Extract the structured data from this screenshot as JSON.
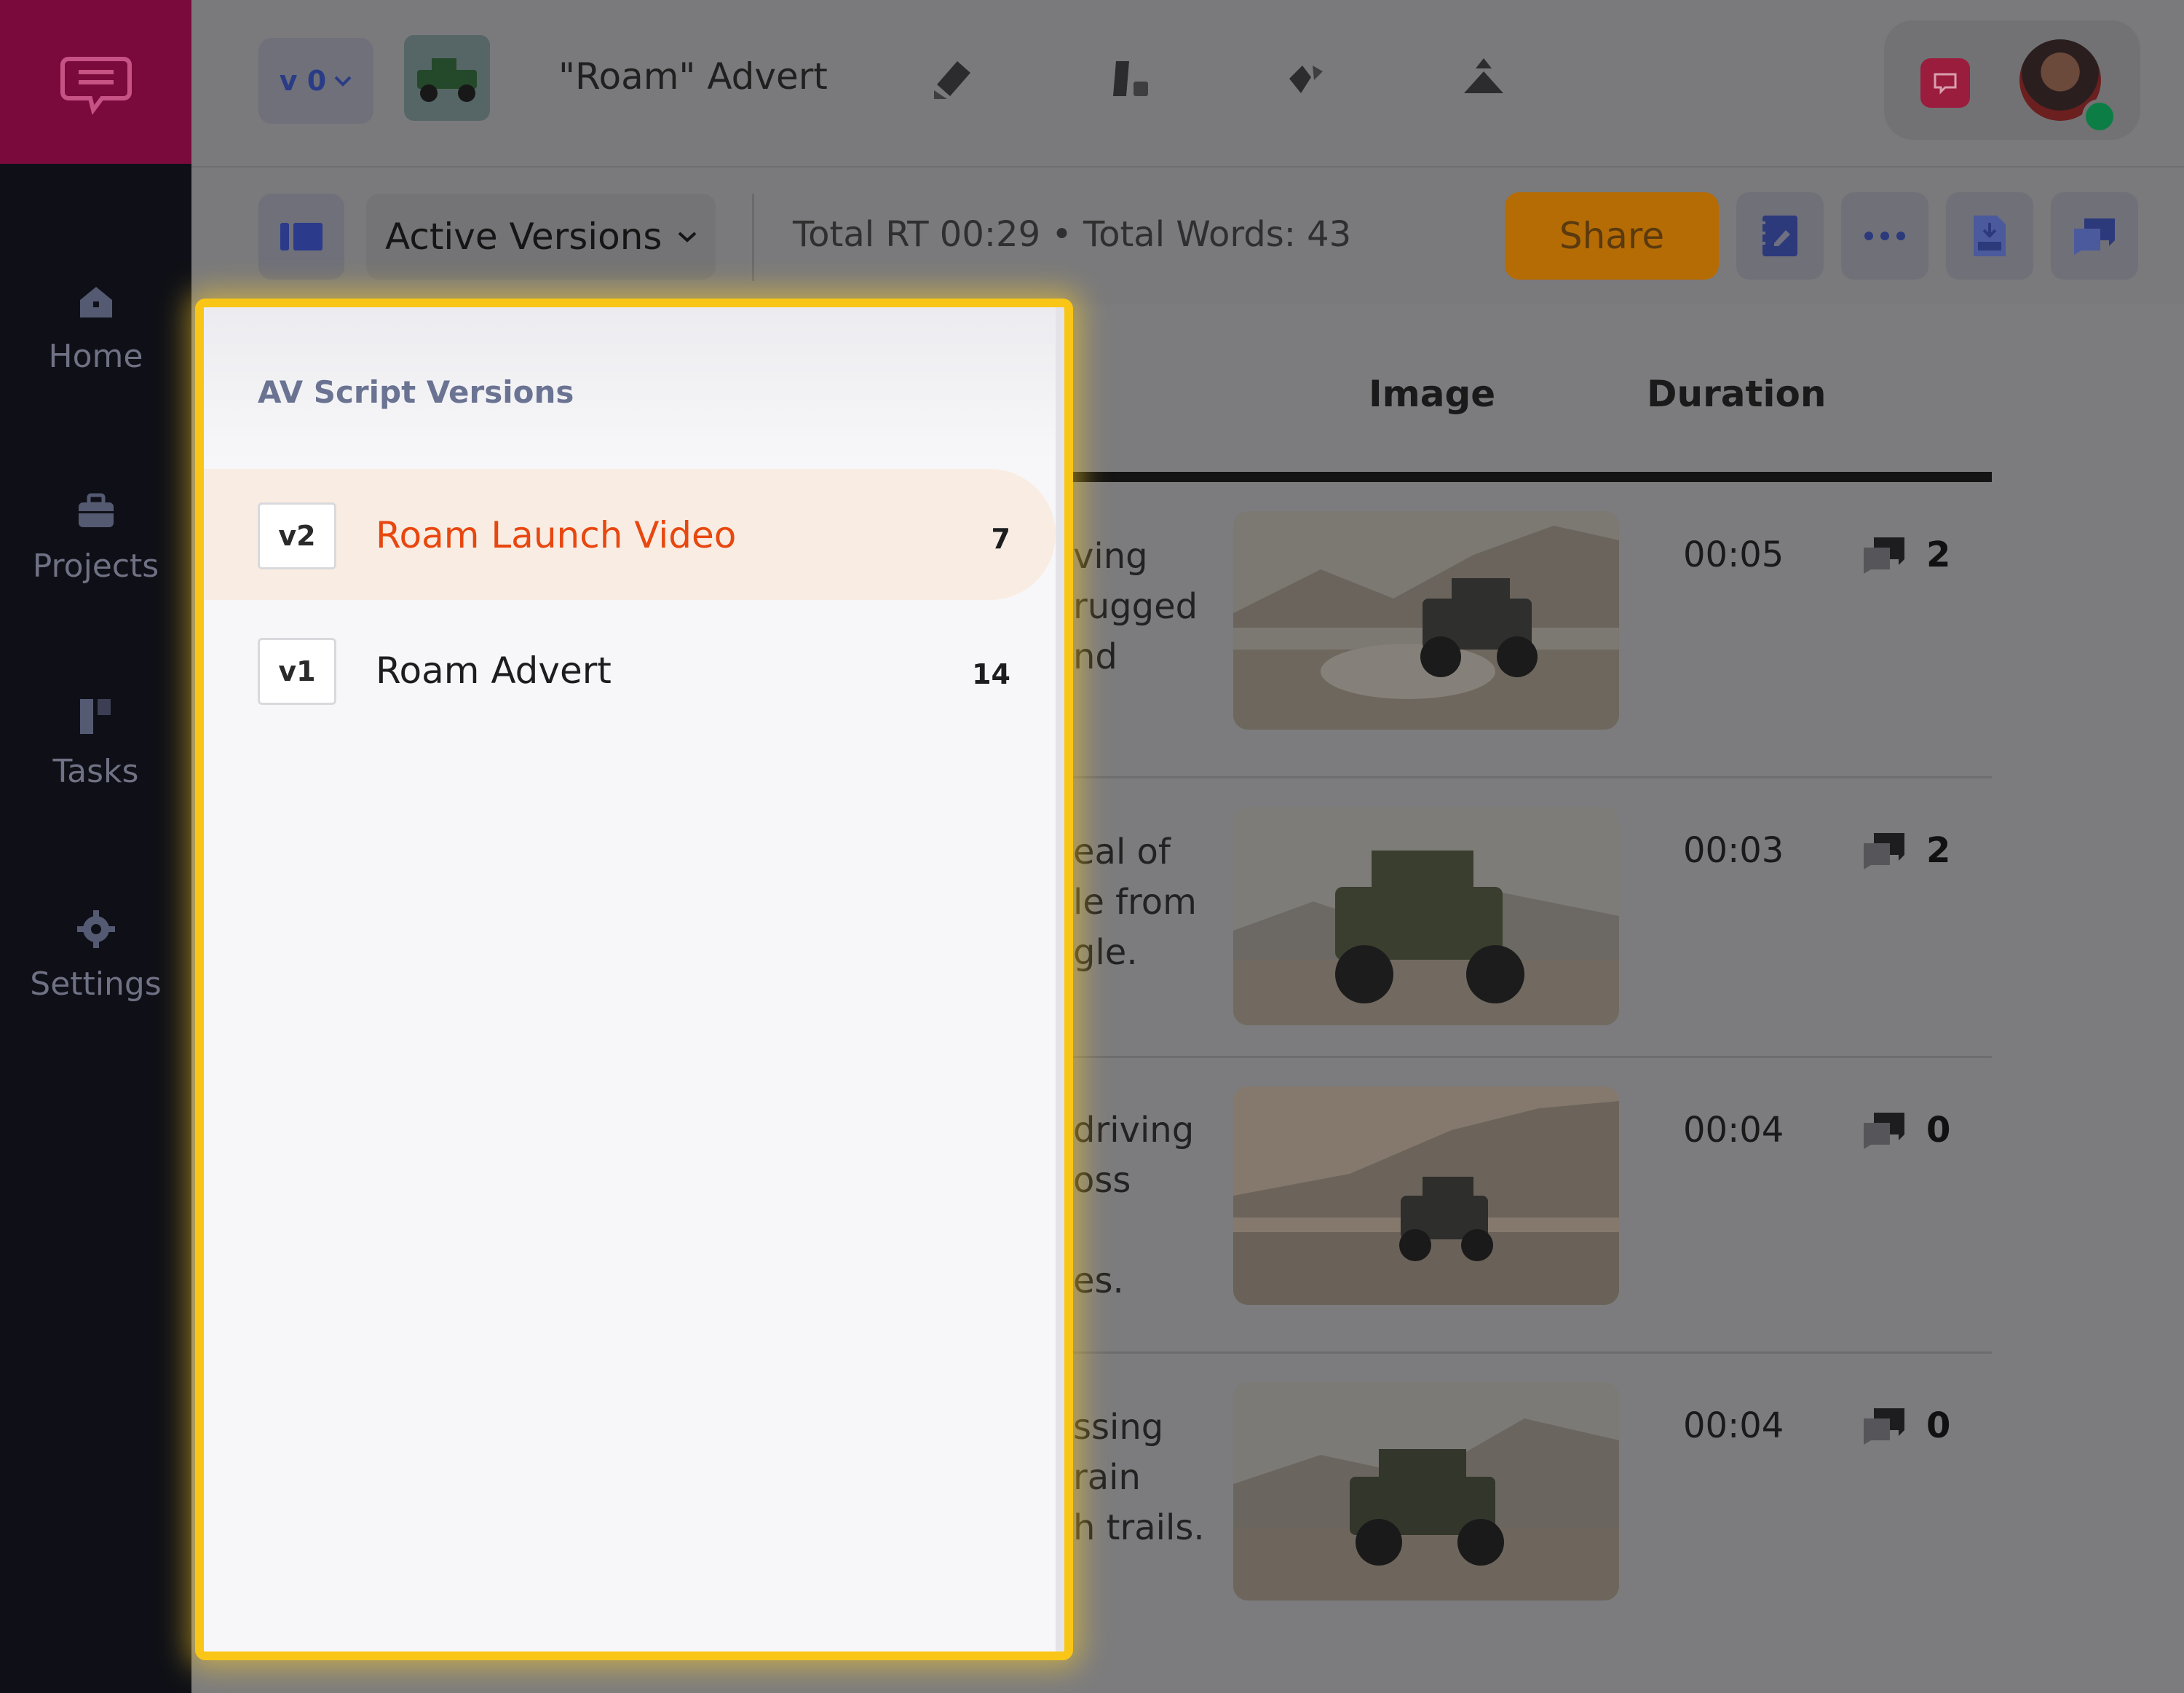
{
  "sidebar": {
    "logo_icon": "chat-logo-icon",
    "items": [
      {
        "label": "Home",
        "icon": "home-icon"
      },
      {
        "label": "Projects",
        "icon": "briefcase-icon"
      },
      {
        "label": "Tasks",
        "icon": "tasks-icon"
      },
      {
        "label": "Settings",
        "icon": "gear-icon"
      }
    ]
  },
  "header": {
    "version_label": "v 0",
    "title": "\"Roam\" Advert",
    "tools": [
      "pen-icon",
      "shapes-icon",
      "diamond-icon",
      "triangle-icon"
    ]
  },
  "toolbar": {
    "versions_label": "Active Versions",
    "totals": "Total RT 00:29 • Total Words: 43",
    "share_label": "Share"
  },
  "table": {
    "columns": [
      "Image",
      "Duration"
    ],
    "rows": [
      {
        "text": "ving\nrugged\nnd",
        "duration": "00:05",
        "comments": "2"
      },
      {
        "text": "eal of\nle from\ngle.",
        "duration": "00:03",
        "comments": "2"
      },
      {
        "text": "driving\noss\n\nes.",
        "duration": "00:04",
        "comments": "0"
      },
      {
        "text": "ssing\nrain\nh trails.",
        "duration": "00:04",
        "comments": "0"
      }
    ]
  },
  "versions_panel": {
    "title": "AV Script Versions",
    "items": [
      {
        "badge": "v2",
        "name": "Roam Launch Video",
        "count": "7",
        "active": true
      },
      {
        "badge": "v1",
        "name": "Roam Advert",
        "count": "14",
        "active": false
      }
    ]
  },
  "colors": {
    "accent": "#e8470f",
    "highlight_border": "#f9c617",
    "share": "#b66c05",
    "logo_bg": "#7a0a3b"
  }
}
